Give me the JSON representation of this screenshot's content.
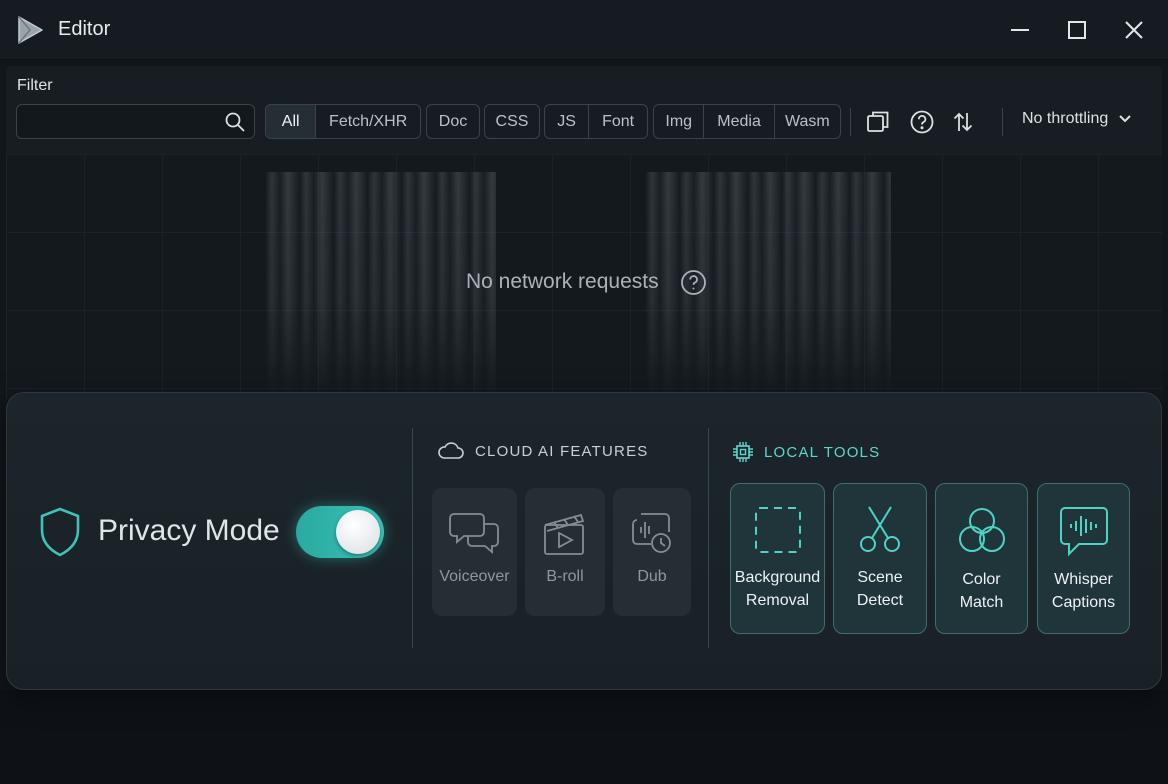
{
  "window": {
    "title": "Editor"
  },
  "filter": {
    "label": "Filter",
    "value": "",
    "placeholder": ""
  },
  "type_filters": [
    {
      "label": "All",
      "active": true
    },
    {
      "label": "Fetch/XHR"
    },
    {
      "label": "Doc"
    },
    {
      "label": "CSS"
    },
    {
      "label": "JS"
    },
    {
      "label": "Font"
    },
    {
      "label": "Img"
    },
    {
      "label": "Media"
    },
    {
      "label": "Wasm"
    }
  ],
  "throttling": {
    "selected": "No throttling"
  },
  "empty_state": {
    "message": "No network requests"
  },
  "privacy": {
    "label": "Privacy Mode",
    "enabled": true
  },
  "cloud_section": {
    "title": "CLOUD AI FEATURES",
    "items": [
      {
        "label": "Voiceover",
        "icon": "chat-bubbles-icon"
      },
      {
        "label": "B-roll",
        "icon": "clapperboard-icon"
      },
      {
        "label": "Dub",
        "icon": "dub-icon"
      }
    ]
  },
  "local_section": {
    "title": "LOCAL TOOLS",
    "items": [
      {
        "line1": "Background",
        "line2": "Removal",
        "icon": "dashed-selection-icon"
      },
      {
        "line1": "Scene",
        "line2": "Detect",
        "icon": "scissors-icon"
      },
      {
        "line1": "Color",
        "line2": "Match",
        "icon": "color-circles-icon"
      },
      {
        "line1": "Whisper",
        "line2": "Captions",
        "icon": "waveform-bubble-icon"
      }
    ]
  },
  "colors": {
    "accent": "#39c2b8",
    "background": "#11161b",
    "card": "#1c252b"
  }
}
